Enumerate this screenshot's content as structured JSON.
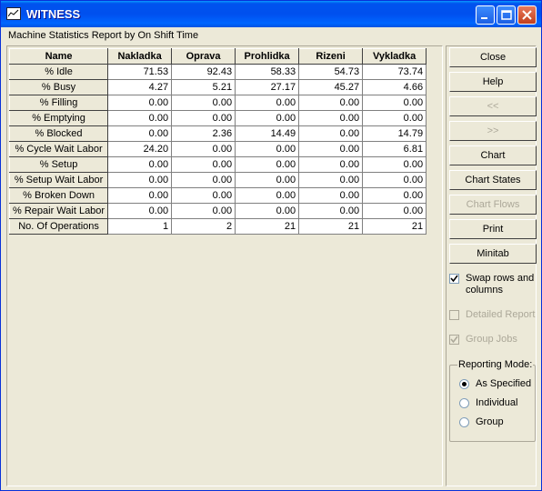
{
  "window": {
    "title": "WITNESS"
  },
  "header": {
    "report_label": "Machine Statistics   Report by On Shift Time"
  },
  "table": {
    "columns": [
      "Name",
      "Nakladka",
      "Oprava",
      "Prohlidka",
      "Rizeni",
      "Vykladka"
    ],
    "rows": [
      [
        "% Idle",
        "71.53",
        "92.43",
        "58.33",
        "54.73",
        "73.74"
      ],
      [
        "% Busy",
        "4.27",
        "5.21",
        "27.17",
        "45.27",
        "4.66"
      ],
      [
        "% Filling",
        "0.00",
        "0.00",
        "0.00",
        "0.00",
        "0.00"
      ],
      [
        "% Emptying",
        "0.00",
        "0.00",
        "0.00",
        "0.00",
        "0.00"
      ],
      [
        "% Blocked",
        "0.00",
        "2.36",
        "14.49",
        "0.00",
        "14.79"
      ],
      [
        "% Cycle Wait Labor",
        "24.20",
        "0.00",
        "0.00",
        "0.00",
        "6.81"
      ],
      [
        "% Setup",
        "0.00",
        "0.00",
        "0.00",
        "0.00",
        "0.00"
      ],
      [
        "% Setup Wait Labor",
        "0.00",
        "0.00",
        "0.00",
        "0.00",
        "0.00"
      ],
      [
        "% Broken Down",
        "0.00",
        "0.00",
        "0.00",
        "0.00",
        "0.00"
      ],
      [
        "% Repair Wait Labor",
        "0.00",
        "0.00",
        "0.00",
        "0.00",
        "0.00"
      ],
      [
        "No. Of Operations",
        "1",
        "2",
        "21",
        "21",
        "21"
      ]
    ]
  },
  "buttons": {
    "close": "Close",
    "help": "Help",
    "prev": "<<",
    "next": ">>",
    "chart": "Chart",
    "chart_states": "Chart States",
    "chart_flows": "Chart Flows",
    "print": "Print",
    "minitab": "Minitab"
  },
  "options": {
    "swap_rows": {
      "label": "Swap rows and columns",
      "checked": true
    },
    "detailed_report": {
      "label": "Detailed Report",
      "checked": false,
      "enabled": false
    },
    "group_jobs": {
      "label": "Group Jobs",
      "checked": true,
      "enabled": false
    }
  },
  "reporting_mode": {
    "title": "Reporting Mode:",
    "options": [
      "As Specified",
      "Individual",
      "Group"
    ],
    "selected": "As Specified"
  }
}
